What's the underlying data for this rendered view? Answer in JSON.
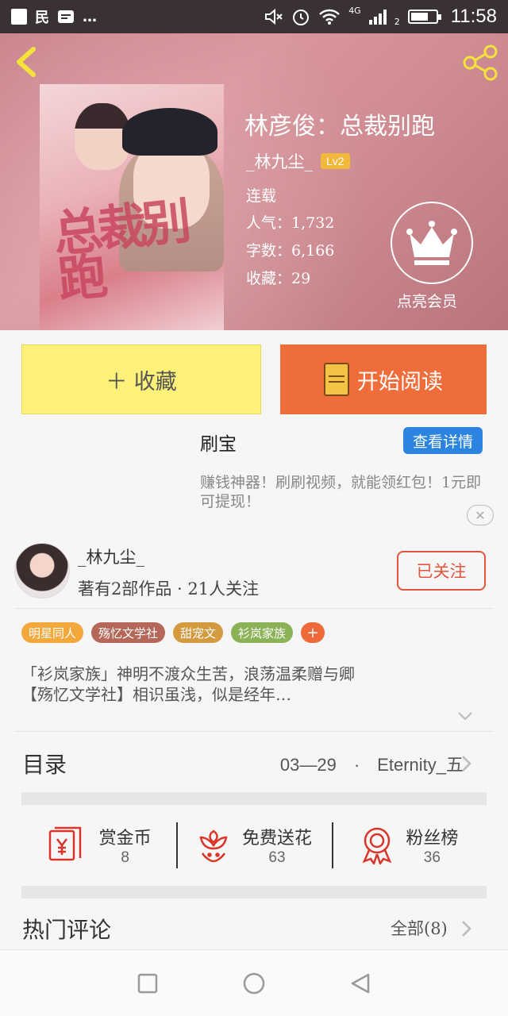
{
  "status_bar": {
    "left_glyphs": [
      "民",
      "…"
    ],
    "network": "4G",
    "sim": "2",
    "time": "11:58",
    "battery_level": 0.7
  },
  "header": {
    "book_title": "林彦俊：总裁别跑",
    "author": "_林九尘_",
    "author_level": "Lv2",
    "status": "连载",
    "popularity_label": "人气：1,732",
    "word_count_label": "字数：6,166",
    "favorites_label": "收藏：29",
    "vip_label": "点亮会员",
    "cover_art_text": "总裁别跑"
  },
  "actions": {
    "collect_label": "＋ 收藏",
    "read_label": "开始阅读"
  },
  "ad": {
    "title": "刷宝",
    "detail_button": "查看详情",
    "description": "赚钱神器！刷刷视频，就能领红包！1元即可提现！",
    "close_glyph": "✕"
  },
  "author_card": {
    "name": "_林九尘_",
    "meta": "著有2部作品 · 21人关注",
    "follow_label": "已关注"
  },
  "tags": [
    {
      "label": "明星同人",
      "color": "#f2a83a"
    },
    {
      "label": "殇忆文学社",
      "color": "#b5675a"
    },
    {
      "label": "甜宠文",
      "color": "#d49a3f"
    },
    {
      "label": "衫岚家族",
      "color": "#8bb257"
    }
  ],
  "tag_add_label": "+",
  "intro": {
    "line1": "「衫岚家族」神明不渡众生苦，浪荡温柔赠与卿",
    "line2": "【殇忆文学社】相识虽浅，似是经年…"
  },
  "catalog": {
    "label": "目录",
    "latest": "03—29　·　Eternity_五"
  },
  "rewards": [
    {
      "label": "赏金币",
      "count": "8",
      "icon": "red-envelope-icon"
    },
    {
      "label": "免费送花",
      "count": "63",
      "icon": "flower-icon"
    },
    {
      "label": "粉丝榜",
      "count": "36",
      "icon": "medal-icon"
    }
  ],
  "hot_comments": {
    "title": "热门评论",
    "all_label": "全部(8)"
  },
  "colors": {
    "accent_orange": "#ef6c3b",
    "collect_yellow": "#fdf17a",
    "ad_blue": "#2a84e0",
    "icon_red": "#d9352a"
  }
}
